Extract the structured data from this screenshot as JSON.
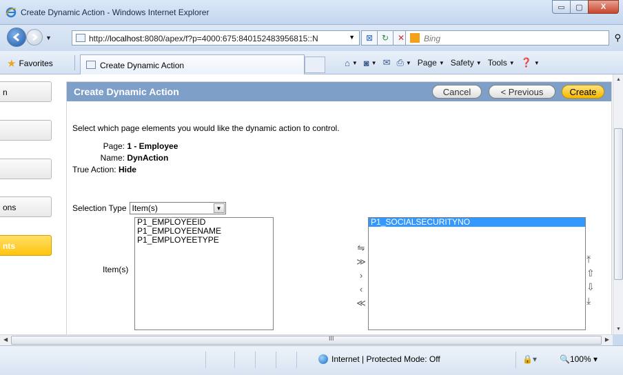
{
  "window": {
    "title": "Create Dynamic Action - Windows Internet Explorer",
    "minimize": "▭",
    "maximize": "▢",
    "close": "X"
  },
  "address": {
    "url_prefix": "http://",
    "url_host": "localhost",
    "url_rest": ":8080/apex/f?p=4000:675:840152483956815::N",
    "search_placeholder": "Bing"
  },
  "favorites": {
    "label": "Favorites",
    "tab_label": "Create Dynamic Action"
  },
  "commands": {
    "page": "Page",
    "safety": "Safety",
    "tools": "Tools"
  },
  "leftnav": {
    "items": [
      "n",
      "",
      "",
      "ons",
      "nts"
    ]
  },
  "region": {
    "title": "Create Dynamic Action",
    "cancel": "Cancel",
    "previous": "< Previous",
    "create": "Create"
  },
  "form": {
    "instruction": "Select which page elements you would like the dynamic action to control.",
    "page_label": "Page:",
    "page_value": "1 - Employee",
    "name_label": "Name:",
    "name_value": "DynAction",
    "true_action_label": "True Action:",
    "true_action_value": "Hide",
    "selection_type_label": "Selection Type",
    "selection_type_value": "Item(s)",
    "items_label": "Item(s)",
    "available_items": [
      "P1_EMPLOYEEID",
      "P1_EMPLOYEENAME",
      "P1_EMPLOYEETYPE"
    ],
    "selected_items": [
      "P1_SOCIALSECURITYNO"
    ]
  },
  "status": {
    "zone": "Internet | Protected Mode: Off",
    "zoom": "100%",
    "scroll_grip": "III"
  }
}
